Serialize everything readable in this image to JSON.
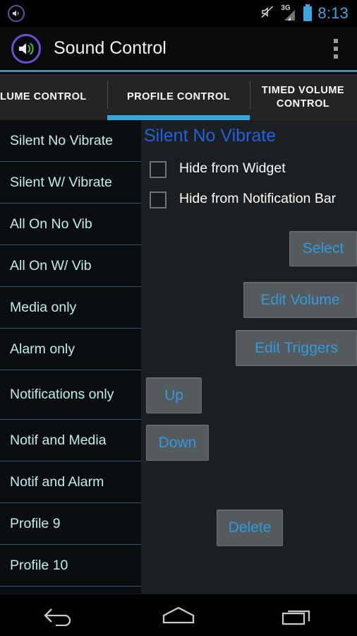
{
  "status_bar": {
    "notification_icon": "volume-notification-icon",
    "mute_icon": "mute-icon",
    "signal_label": "3G",
    "signal_icon": "signal-bars-icon",
    "battery_icon": "battery-icon",
    "time": "8:13"
  },
  "action_bar": {
    "app_icon": "speaker-app-icon",
    "title": "Sound Control",
    "overflow_icon": "overflow-menu-icon",
    "accent_color": "#3d8fb5"
  },
  "tabs": [
    {
      "label": "LUME CONTROL",
      "active": false
    },
    {
      "label": "PROFILE CONTROL",
      "active": true
    },
    {
      "label": "TIMED VOLUME CONTROL",
      "active": false
    }
  ],
  "profile_list": [
    {
      "label": "Silent No Vibrate",
      "two_line": false
    },
    {
      "label": "Silent W/ Vibrate",
      "two_line": false
    },
    {
      "label": "All On No Vib",
      "two_line": false
    },
    {
      "label": "All On W/ Vib",
      "two_line": false
    },
    {
      "label": "Media only",
      "two_line": false
    },
    {
      "label": "Alarm only",
      "two_line": false
    },
    {
      "label": "Notifications only",
      "two_line": true
    },
    {
      "label": "Notif and Media",
      "two_line": false
    },
    {
      "label": "Notif and Alarm",
      "two_line": false
    },
    {
      "label": "Profile 9",
      "two_line": false
    },
    {
      "label": "Profile 10",
      "two_line": false
    }
  ],
  "detail": {
    "title": "Silent No Vibrate",
    "title_color": "#1f62dd",
    "checkboxes": [
      {
        "label": "Hide from Widget",
        "checked": false
      },
      {
        "label": "Hide from Notification Bar",
        "checked": false
      }
    ],
    "buttons": {
      "select": "Select",
      "edit_volume": "Edit Volume",
      "edit_triggers": "Edit Triggers",
      "up": "Up",
      "down": "Down",
      "delete": "Delete"
    },
    "button_text_color": "#2e9be0",
    "button_bg_color": "#555a5d"
  },
  "nav_bar": {
    "back_icon": "back-arrow-icon",
    "home_icon": "home-icon",
    "recents_icon": "recent-apps-icon"
  }
}
